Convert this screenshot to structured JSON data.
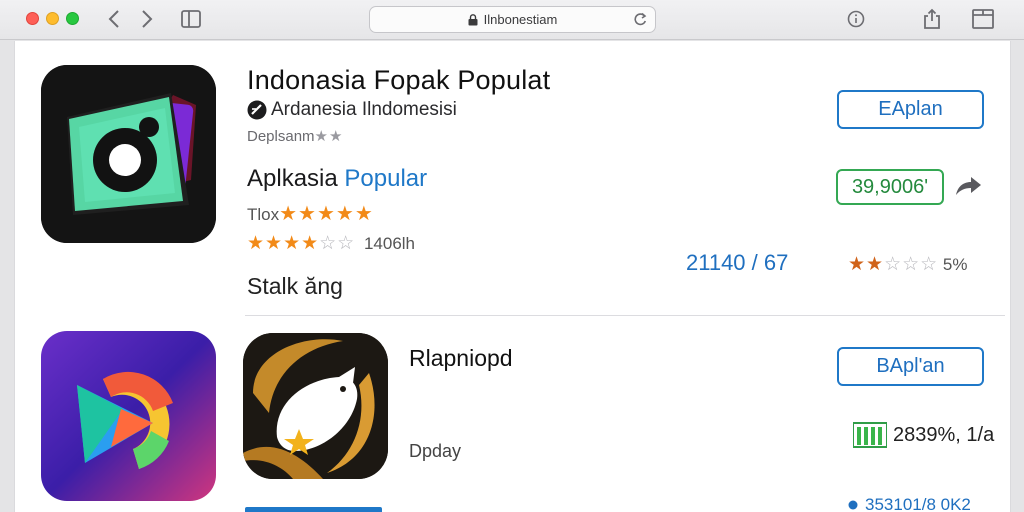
{
  "browser": {
    "address": "Ilnbonestiam"
  },
  "apps": [
    {
      "title": "Indonasia Fopak Populat",
      "developer": "Ardanesia Ilndomesisi",
      "category": "Deplsanm",
      "section_title_prefix": "Aplkasia",
      "section_title_suffix": "Popular",
      "label_a": "Tlox",
      "review_count": "1406lh",
      "stat_left": "21140 / 67",
      "percent": "5%",
      "status": "Stalk ăng",
      "button_label": "EAplan",
      "price": "39,9006'"
    },
    {
      "title": "Rlapniopd",
      "subtitle": "Dpday",
      "button_label": "BApl'an",
      "price": "2839%, 1/a",
      "footer_value": "353101/8 0K2"
    }
  ],
  "colors": {
    "accent_blue": "#1f78c8",
    "price_green": "#34a853",
    "star_orange": "#f28a18"
  }
}
